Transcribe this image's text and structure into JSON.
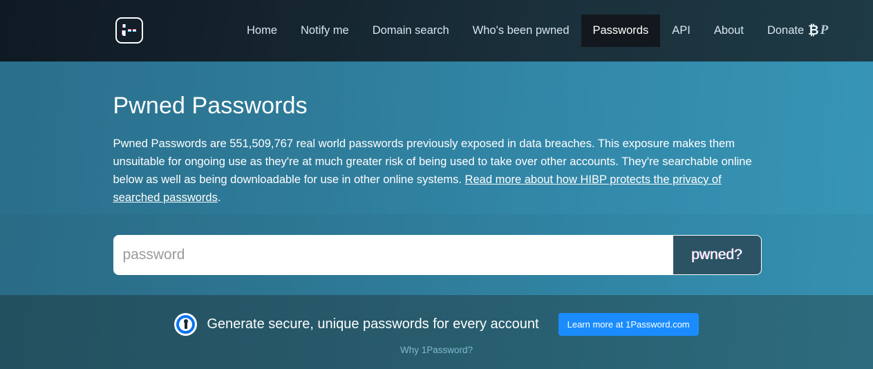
{
  "header": {
    "logo": {
      "name": "hibp-logo",
      "glyph": ";--"
    },
    "nav": [
      {
        "label": "Home",
        "active": false
      },
      {
        "label": "Notify me",
        "active": false
      },
      {
        "label": "Domain search",
        "active": false
      },
      {
        "label": "Who's been pwned",
        "active": false
      },
      {
        "label": "Passwords",
        "active": true
      },
      {
        "label": "API",
        "active": false
      },
      {
        "label": "About",
        "active": false
      },
      {
        "label": "Donate",
        "active": false,
        "icons": [
          "bitcoin-icon",
          "paypal-icon"
        ]
      }
    ],
    "donate": {
      "label": "Donate",
      "bitcoin_glyph": "₿",
      "paypal_glyph": "P"
    },
    "colors": {
      "background_left": "#0f1923",
      "background_right": "#1e3a45",
      "active_item": "#12181d",
      "link": "#d7e6ee"
    }
  },
  "hero": {
    "title": "Pwned Passwords",
    "paragraph_before_link": "Pwned Passwords are 551,509,767 real world passwords previously exposed in data breaches. This exposure makes them unsuitable for ongoing use as they're at much greater risk of being used to take over other accounts. They're searchable online below as well as being downloadable for use in other online systems. ",
    "link_text": "Read more about how HIBP protects the privacy of searched passwords",
    "paragraph_after_link": ".",
    "password_count": "551,509,767",
    "colors": {
      "background_left": "#2a6f8c",
      "background_right": "#3795b5",
      "text": "#ffffff"
    }
  },
  "search": {
    "input_value": "",
    "input_placeholder": "password",
    "button_label": "pwned?",
    "colors": {
      "input_background": "#ffffff",
      "placeholder": "#9a9a9a",
      "button_background": "#2c5364",
      "button_text": "#ffffff"
    }
  },
  "onepassword_banner": {
    "logo_name": "1password-logo",
    "headline": "Generate secure, unique passwords for every account",
    "cta_label": "Learn more at 1Password.com",
    "why_link_label": "Why 1Password?",
    "colors": {
      "background_left": "#23505f",
      "background_right": "#2d6c7e",
      "cta_background": "#1a8cff",
      "logo_ring": "#0572ec",
      "why_link": "#7fb9ce"
    }
  }
}
